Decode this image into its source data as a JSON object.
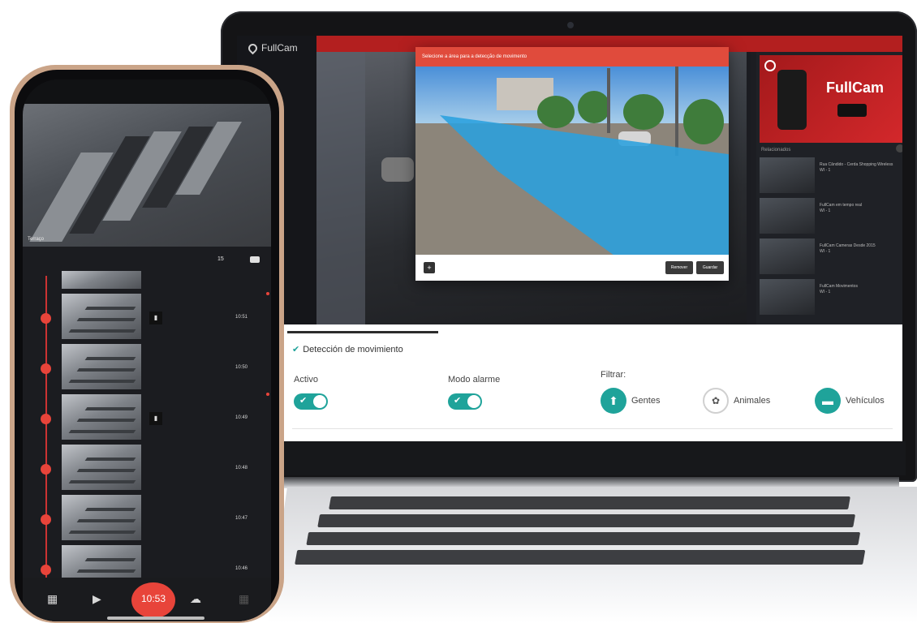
{
  "laptop": {
    "app_name": "FullCam",
    "dialog": {
      "title": "Selecione a área para a detecção de movimento",
      "plus_label": "+",
      "cancel_label": "Remover",
      "save_label": "Guardar"
    },
    "ad": {
      "brand": "FullCam"
    },
    "related": {
      "title": "Relacionados",
      "items": [
        {
          "title": "Rua Cândido - Cerda Shopping Wireless",
          "meta": "WI - 1"
        },
        {
          "title": "FullCam em tempo real",
          "meta": "WI - 1"
        },
        {
          "title": "FullCam Cameras Desde 2015",
          "meta": "WI - 1"
        },
        {
          "title": "FullCam Movimentos",
          "meta": "WI - 1"
        }
      ]
    },
    "settings": {
      "heading": "Detección de movimiento",
      "active_label": "Activo",
      "alarm_label": "Modo alarme",
      "filter_label": "Filtrar:",
      "filters": [
        {
          "label": "Gentes",
          "icon": "person-icon",
          "active": true
        },
        {
          "label": "Animales",
          "icon": "paw-icon",
          "active": false
        },
        {
          "label": "Vehículos",
          "icon": "car-icon",
          "active": true
        }
      ]
    }
  },
  "phone": {
    "camera_label": "Terraço",
    "count": "15",
    "timeline": [
      {
        "time": "10:51",
        "marked": true
      },
      {
        "time": "10:50",
        "marked": false
      },
      {
        "time": "10:49",
        "marked": true
      },
      {
        "time": "10:48",
        "marked": false
      },
      {
        "time": "10:47",
        "marked": false
      },
      {
        "time": "10:46",
        "marked": false
      }
    ],
    "time_button": "10:53"
  },
  "colors": {
    "accent": "#1fa39a",
    "red": "#e8443a",
    "brand_red": "#c2211f"
  }
}
